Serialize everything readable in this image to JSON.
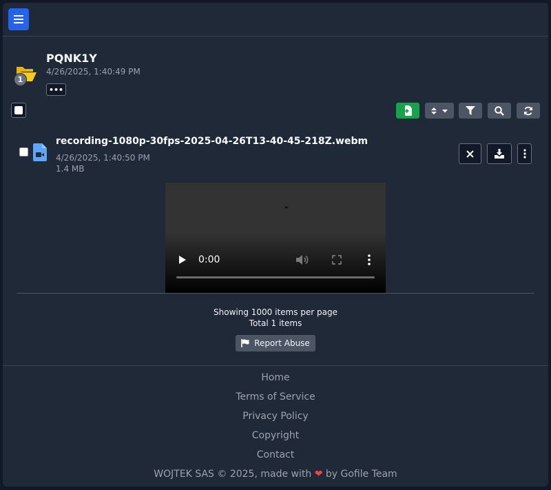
{
  "folder": {
    "name": "PQNK1Y",
    "date": "4/26/2025, 1:40:49 PM",
    "item_count": "1",
    "more_label": "•••"
  },
  "toolbar": {
    "icons": [
      "import-icon",
      "sort-icon",
      "filter-icon",
      "search-icon",
      "refresh-icon"
    ]
  },
  "file": {
    "name": "recording-1080p-30fps-2025-04-26T13-40-45-218Z.webm",
    "date": "4/26/2025, 1:40:50 PM",
    "size": "1.4 MB",
    "actions": [
      "close-icon",
      "download-icon",
      "more-vertical-icon"
    ]
  },
  "player": {
    "time": "0:00",
    "progress": 0
  },
  "pagination": {
    "per_page_text": "Showing 1000 items per page",
    "total_text": "Total 1 items"
  },
  "report": {
    "label": "Report Abuse"
  },
  "footer": {
    "links": [
      "Home",
      "Terms of Service",
      "Privacy Policy",
      "Copyright",
      "Contact"
    ],
    "copyright_prefix": "WOJTEK SAS © 2025, made with",
    "heart": "❤",
    "copyright_suffix": "by Gofile Team"
  },
  "colors": {
    "accent_blue": "#2563eb",
    "import_green": "#16a34a",
    "folder_yellow": "#facc15",
    "video_icon_blue": "#60a5fa",
    "heart_red": "#ef4444"
  }
}
